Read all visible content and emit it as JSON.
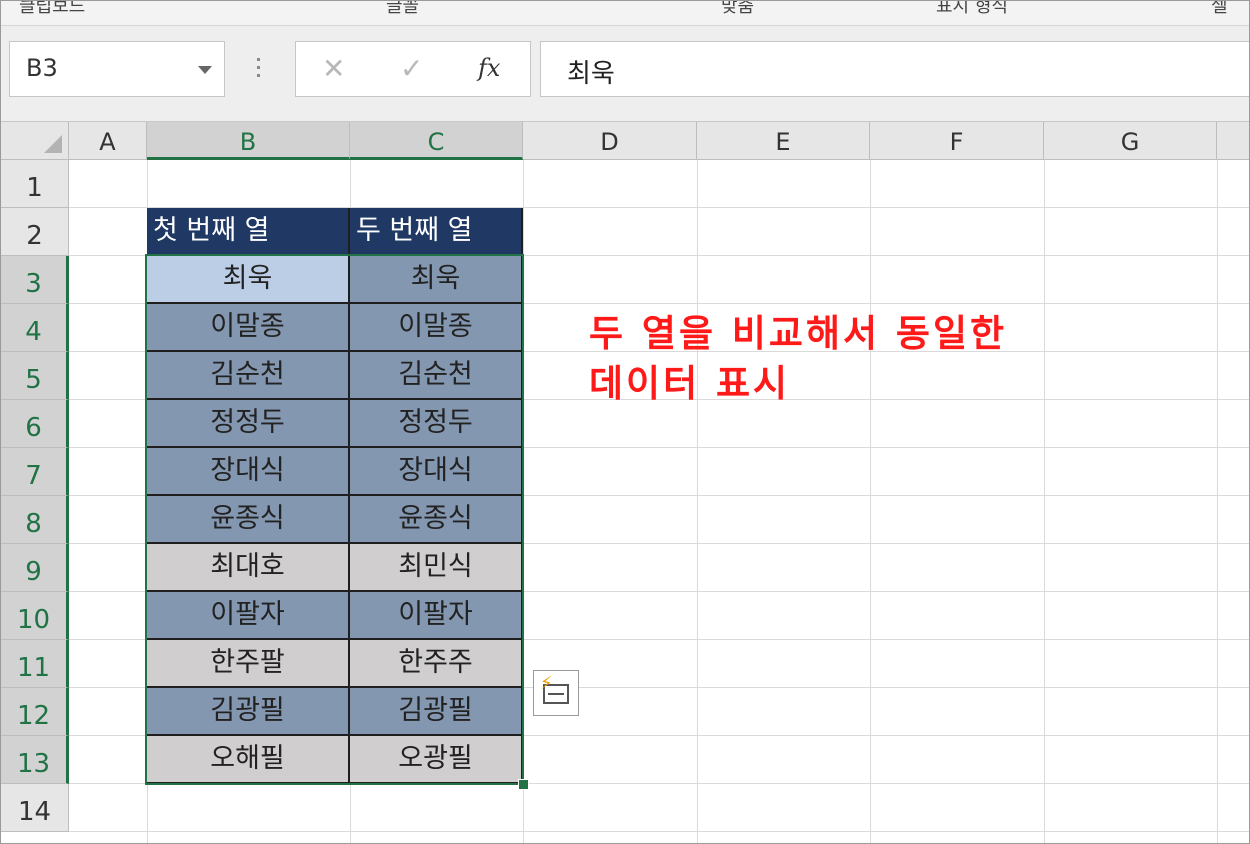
{
  "ribbon": {
    "fragments": [
      "클립보드",
      "글꼴",
      "맞춤",
      "표시 형식",
      "셀"
    ]
  },
  "formula_bar": {
    "name_box": "B3",
    "cancel_glyph": "✕",
    "enter_glyph": "✓",
    "fx_label": "fx",
    "formula_value": "최욱"
  },
  "columns": [
    {
      "label": "A",
      "selected": false
    },
    {
      "label": "B",
      "selected": true
    },
    {
      "label": "C",
      "selected": true
    },
    {
      "label": "D",
      "selected": false
    },
    {
      "label": "E",
      "selected": false
    },
    {
      "label": "F",
      "selected": false
    },
    {
      "label": "G",
      "selected": false
    }
  ],
  "rows": [
    "1",
    "2",
    "3",
    "4",
    "5",
    "6",
    "7",
    "8",
    "9",
    "10",
    "11",
    "12",
    "13",
    "14"
  ],
  "table": {
    "headers": [
      "첫 번째 열",
      "두 번째 열"
    ],
    "data": [
      {
        "first": "최욱",
        "second": "최욱",
        "match": true
      },
      {
        "first": "이말종",
        "second": "이말종",
        "match": true
      },
      {
        "first": "김순천",
        "second": "김순천",
        "match": true
      },
      {
        "first": "정정두",
        "second": "정정두",
        "match": true
      },
      {
        "first": "장대식",
        "second": "장대식",
        "match": true
      },
      {
        "first": "윤종식",
        "second": "윤종식",
        "match": true
      },
      {
        "first": "최대호",
        "second": "최민식",
        "match": false
      },
      {
        "first": "이팔자",
        "second": "이팔자",
        "match": true
      },
      {
        "first": "한주팔",
        "second": "한주주",
        "match": false
      },
      {
        "first": "김광필",
        "second": "김광필",
        "match": true
      },
      {
        "first": "오해필",
        "second": "오광필",
        "match": false
      }
    ]
  },
  "annotation": {
    "line1": "두 열을 비교해서 동일한",
    "line2": "데이터 표시",
    "color": "#ff1a1a"
  },
  "colors": {
    "header_fill": "#1f3864",
    "match_fill": "#8497b0",
    "nomatch_fill": "#d0cece",
    "active_fill": "#bccde6",
    "selection": "#217346"
  }
}
